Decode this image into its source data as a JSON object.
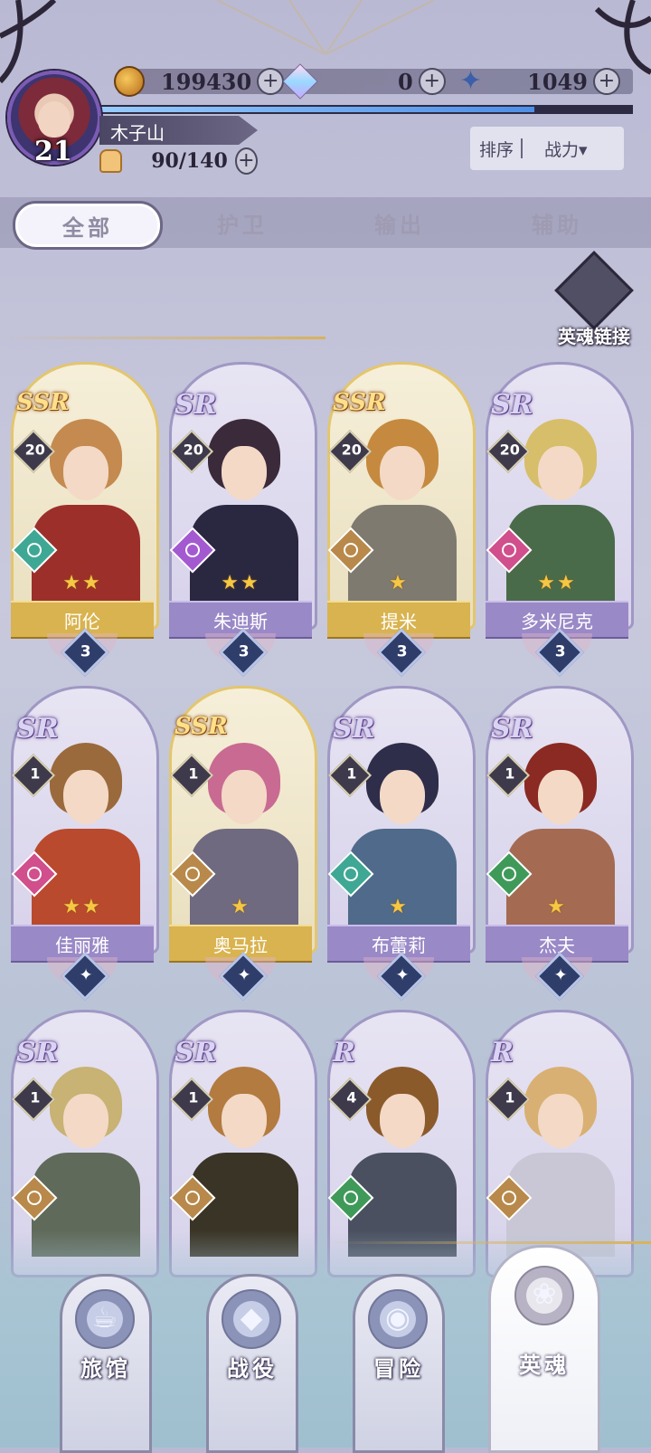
{
  "resources": {
    "gold": "199430",
    "gems": "0",
    "crystals": "1049"
  },
  "player": {
    "name": "木子山",
    "level": "21",
    "stamina": "90/140",
    "xp_progress": 0.83
  },
  "sort": {
    "label": "排序",
    "value": "战力▾"
  },
  "tabs": [
    {
      "label": "全部",
      "active": true
    },
    {
      "label": "护卫",
      "active": false
    },
    {
      "label": "输出",
      "active": false
    },
    {
      "label": "辅助",
      "active": false
    }
  ],
  "hero_link": {
    "label": "英魂链接"
  },
  "heroes": [
    {
      "name": "阿伦",
      "rarity": "SSR",
      "level": "20",
      "stars": "★★",
      "badge": "3",
      "plate": "gold",
      "class_icon": "bow-icon",
      "class_color": "#3fa894",
      "hair": "#c48a4f",
      "body": "#9c2f2a"
    },
    {
      "name": "朱迪斯",
      "rarity": "SR",
      "level": "20",
      "stars": "★★",
      "badge": "3",
      "plate": "purple",
      "class_icon": "flask-icon",
      "class_color": "#a35ad1",
      "hair": "#3b2a3a",
      "body": "#2a2740"
    },
    {
      "name": "提米",
      "rarity": "SSR",
      "level": "20",
      "stars": "★",
      "badge": "3",
      "plate": "gold",
      "class_icon": "swirl-icon",
      "class_color": "#b8894a",
      "hair": "#c58a3f",
      "body": "#7e7a70"
    },
    {
      "name": "多米尼克",
      "rarity": "SR",
      "level": "20",
      "stars": "★★",
      "badge": "3",
      "plate": "purple",
      "class_icon": "flask-icon",
      "class_color": "#d04f8c",
      "hair": "#d7be6a",
      "body": "#4a6b4a"
    },
    {
      "name": "佳丽雅",
      "rarity": "SR",
      "level": "1",
      "stars": "★★",
      "badge": "✦",
      "plate": "purple",
      "class_icon": "flask-icon",
      "class_color": "#d04f8c",
      "hair": "#9a6a3c",
      "body": "#b94a2e"
    },
    {
      "name": "奥马拉",
      "rarity": "SSR",
      "level": "1",
      "stars": "★",
      "badge": "✦",
      "plate": "gold",
      "class_icon": "shield-icon",
      "class_color": "#b8894a",
      "hair": "#c96a92",
      "body": "#6f6a80"
    },
    {
      "name": "布蕾莉",
      "rarity": "SR",
      "level": "1",
      "stars": "★",
      "badge": "✦",
      "plate": "purple",
      "class_icon": "bow-icon",
      "class_color": "#3fa894",
      "hair": "#2e2d4a",
      "body": "#4f6a8a"
    },
    {
      "name": "杰夫",
      "rarity": "SR",
      "level": "1",
      "stars": "★",
      "badge": "✦",
      "plate": "purple",
      "class_icon": "gear-icon",
      "class_color": "#3f9a5a",
      "hair": "#8a2a22",
      "body": "#a56a52"
    },
    {
      "name": "",
      "rarity": "SR",
      "level": "1",
      "stars": "",
      "badge": "",
      "plate": "none",
      "class_icon": "shield-icon",
      "class_color": "#b8894a",
      "hair": "#c8b274",
      "body": "#5f6a5a"
    },
    {
      "name": "",
      "rarity": "SR",
      "level": "1",
      "stars": "",
      "badge": "",
      "plate": "none",
      "class_icon": "swirl-icon",
      "class_color": "#b8894a",
      "hair": "#b37b3f",
      "body": "#3a3426"
    },
    {
      "name": "",
      "rarity": "R",
      "level": "4",
      "stars": "",
      "badge": "",
      "plate": "none",
      "class_icon": "gear-icon",
      "class_color": "#3f9a5a",
      "hair": "#8b5a2b",
      "body": "#4a5060"
    },
    {
      "name": "",
      "rarity": "R",
      "level": "1",
      "stars": "",
      "badge": "",
      "plate": "none",
      "class_icon": "swirl-icon",
      "class_color": "#b8894a",
      "hair": "#d9b073",
      "body": "#c9c7d6"
    }
  ],
  "nav": [
    {
      "label": "旅馆",
      "icon": "mug-icon",
      "glyph": "🍺",
      "active": false
    },
    {
      "label": "战役",
      "icon": "battle-icon",
      "glyph": "◆",
      "active": false
    },
    {
      "label": "冒险",
      "icon": "adventure-icon",
      "glyph": "◉",
      "active": false
    },
    {
      "label": "英魂",
      "icon": "hero-icon",
      "glyph": "❀",
      "active": true
    }
  ],
  "colors": {
    "gold_plate": "#d9b34f",
    "purple_plate": "#9a89c7",
    "xp_bar": "#4d8fe8"
  }
}
